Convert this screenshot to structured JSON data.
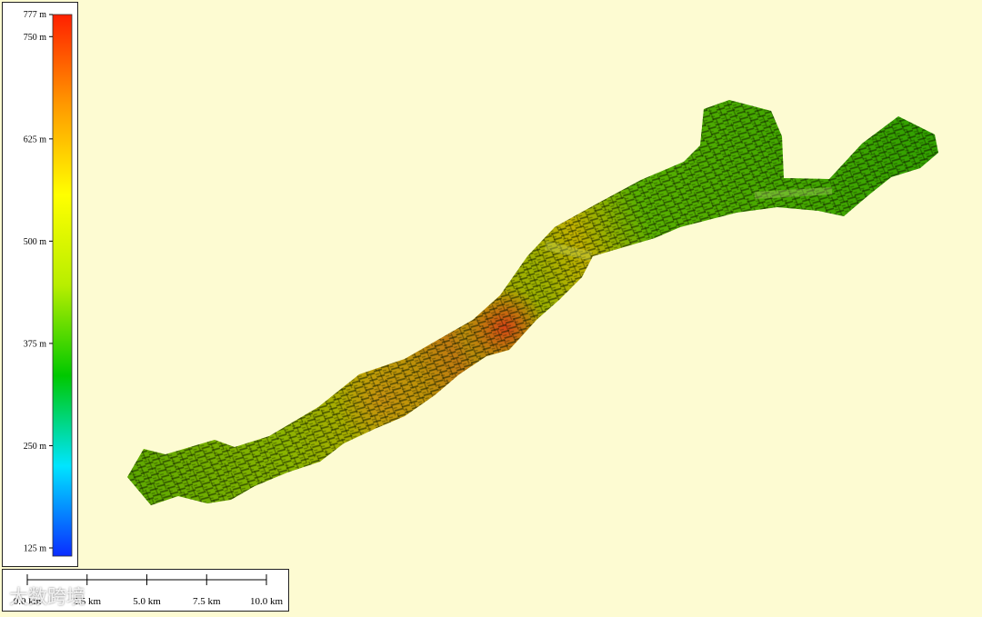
{
  "legend": {
    "max_label": "777 m",
    "ticks": [
      {
        "label": "750 m",
        "value": 750
      },
      {
        "label": "625 m",
        "value": 625
      },
      {
        "label": "500 m",
        "value": 500
      },
      {
        "label": "375 m",
        "value": 375
      },
      {
        "label": "250 m",
        "value": 250
      },
      {
        "label": "125 m",
        "value": 125
      }
    ],
    "min_value": 115,
    "max_value": 777,
    "colors": [
      "#0a2cff",
      "#00e5ff",
      "#00c800",
      "#b8ee00",
      "#ffff00",
      "#ff9900",
      "#ff2000"
    ]
  },
  "scale_bar": {
    "labels": [
      "0.0 km",
      "2.5 km",
      "5.0 km",
      "7.5 km",
      "10.0 km"
    ]
  },
  "watermark": {
    "text": "大数跨境"
  },
  "colors": {
    "background": "#fdfbd2",
    "terrain_low": "#3aa600",
    "terrain_mid": "#c6c400",
    "terrain_high": "#d22a00"
  }
}
